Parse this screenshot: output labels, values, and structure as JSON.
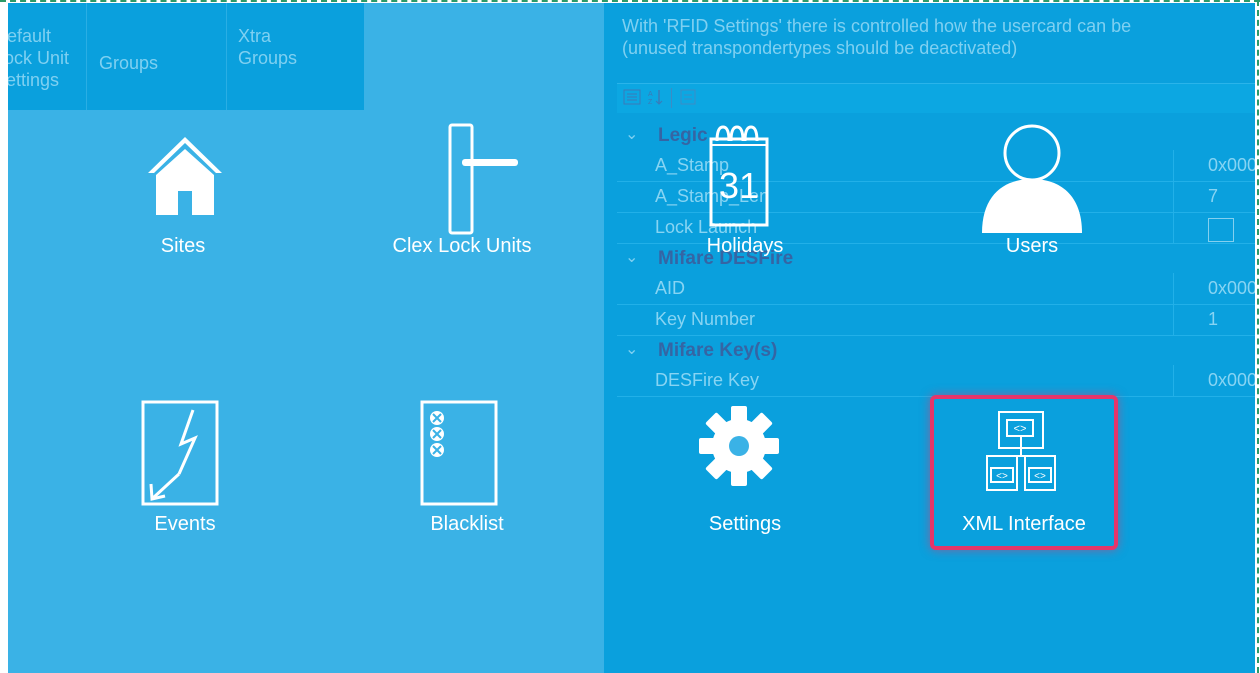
{
  "tabs": [
    {
      "label": "Default\nLock Unit\nSettings"
    },
    {
      "label": "Groups"
    },
    {
      "label": "Xtra\nGroups"
    }
  ],
  "panel": {
    "header": "With 'RFID Settings' there is controlled how the usercard can be\n(unused transpondertypes should be deactivated)",
    "categories": [
      {
        "label": "Legic"
      },
      {
        "label": "Mifare DESFire"
      },
      {
        "label": "Mifare Key(s)"
      }
    ],
    "properties": {
      "a_stamp": {
        "label": "A_Stamp",
        "value": "0x000"
      },
      "a_stamp_len": {
        "label": "A_Stamp_Len",
        "value": "7"
      },
      "lock_launch": {
        "label": "Lock Launch"
      },
      "aid": {
        "label": "AID",
        "value": "0x000"
      },
      "key_number": {
        "label": "Key Number",
        "value": "1"
      },
      "desfire_key": {
        "label": "DESFire Key",
        "value": "0x000"
      }
    }
  },
  "tiles": {
    "sites": {
      "label": "Sites",
      "icon": "house-icon"
    },
    "lock_units": {
      "label": "Clex Lock Units",
      "icon": "door-handle-icon"
    },
    "holidays": {
      "label": "Holidays",
      "icon": "calendar-icon",
      "day": "31"
    },
    "users": {
      "label": "Users",
      "icon": "user-icon"
    },
    "events": {
      "label": "Events",
      "icon": "lightning-icon"
    },
    "blacklist": {
      "label": "Blacklist",
      "icon": "blacklist-icon"
    },
    "settings": {
      "label": "Settings",
      "icon": "gear-icon"
    },
    "xml": {
      "label": "XML Interface",
      "icon": "xml-interface-icon"
    }
  },
  "colors": {
    "background": "#3ab2e6",
    "panel": "#0aa0dd",
    "highlight": "#e6356a",
    "category_text": "#3565a4"
  }
}
